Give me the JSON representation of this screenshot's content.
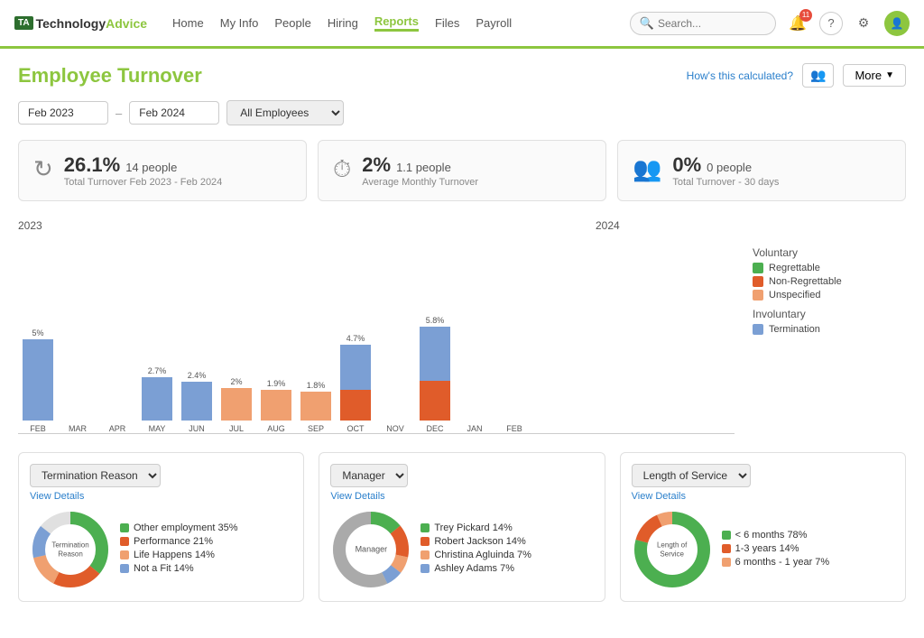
{
  "nav": {
    "logo_prefix": "TA",
    "logo_name1": "Technology",
    "logo_name2": "Advice",
    "links": [
      {
        "label": "Home",
        "active": false
      },
      {
        "label": "My Info",
        "active": false
      },
      {
        "label": "People",
        "active": false
      },
      {
        "label": "Hiring",
        "active": false
      },
      {
        "label": "Reports",
        "active": true
      },
      {
        "label": "Files",
        "active": false
      },
      {
        "label": "Payroll",
        "active": false
      }
    ],
    "search_placeholder": "Search...",
    "notif_count": "11"
  },
  "page": {
    "title": "Employee Turnover",
    "hows_link": "How's this calculated?",
    "more_label": "More"
  },
  "filters": {
    "date_from": "Feb 2023",
    "date_to": "Feb 2024",
    "employee_filter": "All Employees"
  },
  "stat_cards": [
    {
      "pct": "26.1%",
      "count": "14 people",
      "label": "Total Turnover Feb 2023 - Feb 2024",
      "icon": "↻"
    },
    {
      "pct": "2%",
      "count": "1.1 people",
      "label": "Average Monthly Turnover",
      "icon": "⏱"
    },
    {
      "pct": "0%",
      "count": "0 people",
      "label": "Total Turnover - 30 days",
      "icon": "👥"
    }
  ],
  "chart": {
    "year_2023": "2023",
    "year_2024": "2024",
    "bars": [
      {
        "month": "FEB",
        "label": "5%",
        "involuntary": 90,
        "voluntary": 0,
        "unspecified": 0
      },
      {
        "month": "MAR",
        "label": "",
        "involuntary": 0,
        "voluntary": 0,
        "unspecified": 0
      },
      {
        "month": "APR",
        "label": "",
        "involuntary": 0,
        "voluntary": 0,
        "unspecified": 0
      },
      {
        "month": "MAY",
        "label": "2.7%",
        "involuntary": 48,
        "voluntary": 0,
        "unspecified": 0
      },
      {
        "month": "JUN",
        "label": "2.4%",
        "involuntary": 43,
        "voluntary": 0,
        "unspecified": 0
      },
      {
        "month": "JUL",
        "label": "2%",
        "involuntary": 0,
        "voluntary": 0,
        "unspecified": 36
      },
      {
        "month": "AUG",
        "label": "1.9%",
        "involuntary": 0,
        "voluntary": 0,
        "unspecified": 34
      },
      {
        "month": "SEP",
        "label": "1.8%",
        "involuntary": 0,
        "voluntary": 0,
        "unspecified": 32
      },
      {
        "month": "OCT",
        "label": "4.7%",
        "involuntary": 50,
        "voluntary": 0,
        "unspecified": 34
      },
      {
        "month": "NOV",
        "label": "",
        "involuntary": 0,
        "voluntary": 0,
        "unspecified": 0
      },
      {
        "month": "DEC",
        "label": "5.8%",
        "involuntary": 60,
        "voluntary": 0,
        "unspecified": 44
      },
      {
        "month": "JAN",
        "label": "",
        "involuntary": 0,
        "voluntary": 0,
        "unspecified": 0
      },
      {
        "month": "FEB",
        "label": "",
        "involuntary": 0,
        "voluntary": 0,
        "unspecified": 0
      }
    ],
    "legend": {
      "voluntary_label": "Voluntary",
      "regrettable_label": "Regrettable",
      "non_regrettable_label": "Non-Regrettable",
      "unspecified_label": "Unspecified",
      "involuntary_label": "Involuntary",
      "termination_label": "Termination",
      "colors": {
        "regrettable": "#4caf50",
        "non_regrettable": "#e05c2a",
        "unspecified": "#f0a070",
        "termination": "#7b9fd4"
      }
    }
  },
  "bottom_cards": [
    {
      "select_label": "Termination Reason",
      "view_details": "View Details",
      "center_label": "Termination\nReason",
      "items": [
        {
          "label": "Other employment",
          "pct": "35%",
          "color": "#4caf50"
        },
        {
          "label": "Performance",
          "pct": "21%",
          "color": "#e05c2a"
        },
        {
          "label": "Life Happens",
          "pct": "14%",
          "color": "#f0a070"
        },
        {
          "label": "Not a Fit",
          "pct": "14%",
          "color": "#7b9fd4"
        }
      ],
      "donut_colors": [
        "#4caf50",
        "#e05c2a",
        "#f0a070",
        "#7b9fd4",
        "#a0522d"
      ]
    },
    {
      "select_label": "Manager",
      "view_details": "View Details",
      "center_label": "Manager",
      "items": [
        {
          "label": "Trey Pickard",
          "pct": "14%",
          "color": "#4caf50"
        },
        {
          "label": "Robert Jackson",
          "pct": "14%",
          "color": "#e05c2a"
        },
        {
          "label": "Christina Agluinda",
          "pct": "7%",
          "color": "#f0a070"
        },
        {
          "label": "Ashley Adams",
          "pct": "7%",
          "color": "#7b9fd4"
        }
      ],
      "donut_colors": [
        "#4caf50",
        "#e05c2a",
        "#f0a070",
        "#7b9fd4",
        "#888",
        "#aaa"
      ]
    },
    {
      "select_label": "Length of Service",
      "view_details": "View Details",
      "center_label": "Length of\nService",
      "items": [
        {
          "label": "< 6 months",
          "pct": "78%",
          "color": "#4caf50"
        },
        {
          "label": "1-3 years",
          "pct": "14%",
          "color": "#e05c2a"
        },
        {
          "label": "6 months - 1 year",
          "pct": "7%",
          "color": "#f0a070"
        }
      ],
      "donut_colors": [
        "#4caf50",
        "#e05c2a",
        "#f0a070"
      ]
    }
  ]
}
